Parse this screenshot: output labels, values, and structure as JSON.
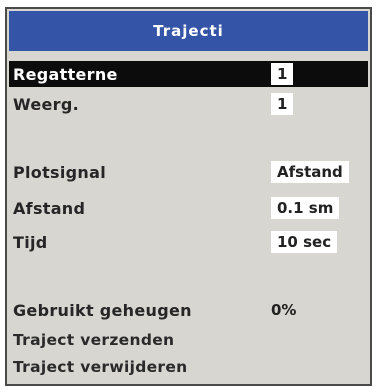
{
  "dialog": {
    "title": "Trajecti"
  },
  "settings": {
    "sequence": {
      "label": "Regatterne",
      "value": "1"
    },
    "repeat": {
      "label": "Weerg.",
      "value": "1"
    },
    "position_signal": {
      "label": "Plotsignal",
      "value": "Afstand"
    },
    "distance": {
      "label": "Afstand",
      "value": "0.1 sm"
    },
    "time": {
      "label": "Tijd",
      "value": "10 sec"
    }
  },
  "memory": {
    "label": "Gebruikt geheugen",
    "value": "0%"
  },
  "actions": {
    "send": "Traject verzenden",
    "delete": "Traject verwijderen"
  }
}
